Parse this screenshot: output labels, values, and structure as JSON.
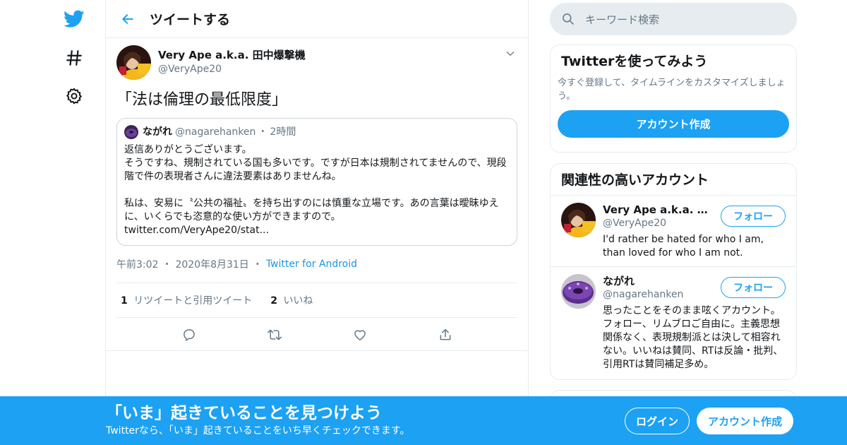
{
  "header": {
    "title": "ツイートする"
  },
  "tweet": {
    "author_name": "Very Ape a.k.a. 田中爆撃機",
    "author_handle": "@VeryApe20",
    "text": "「法は倫理の最低限度」",
    "quote": {
      "name": "ながれ",
      "handle": "@nagarehanken",
      "dot": "・",
      "time": "2時間",
      "body": "返信ありがとうございます。\nそうですね、規制されている国も多いです。ですが日本は規制されてませんので、現段階で件の表現者さんに違法要素はありませんね。\n\n私は、安易に〝公共の福祉〟を持ち出すのには慎重な立場です。あの言葉は曖昧ゆえに、いくらでも恣意的な使い方ができますので。\ntwitter.com/VeryApe20/stat..."
    },
    "time": "午前3:02",
    "date": "2020年8月31日",
    "dot": "・",
    "source": "Twitter for Android",
    "retweet_count": "1",
    "retweet_label": "リツイートと引用ツイート",
    "like_count": "2",
    "like_label": "いいね"
  },
  "search": {
    "placeholder": "キーワード検索"
  },
  "promo": {
    "title": "Twitterを使ってみよう",
    "desc": "今すぐ登録して、タイムラインをカスタマイズしましょう。",
    "button": "アカウント作成"
  },
  "related": {
    "title": "関連性の高いアカウント",
    "accounts": [
      {
        "name": "Very Ape a.k.a. 田中爆撃機",
        "handle": "@VeryApe20",
        "bio": "I'd rather be hated for who I am, than loved for who I am not.",
        "follow": "フォロー"
      },
      {
        "name": "ながれ",
        "handle": "@nagarehanken",
        "bio": "思ったことをそのまま呟くアカウント。フォロー、リムブロご自由に。主義思想関係なく、表現規制派とは決して相容れない。いいねは賛同、RTは反論・批判、引用RTは賛同補足多め。",
        "follow": "フォロー"
      }
    ]
  },
  "banner": {
    "title": "「いま」起きていることを見つけよう",
    "subtitle": "Twitterなら、「いま」起きていることをいち早くチェックできます。",
    "login": "ログイン",
    "signup": "アカウント作成"
  },
  "colors": {
    "accent": "#1da1f2",
    "secondary_text": "#657786",
    "border": "#e6ecf0"
  }
}
